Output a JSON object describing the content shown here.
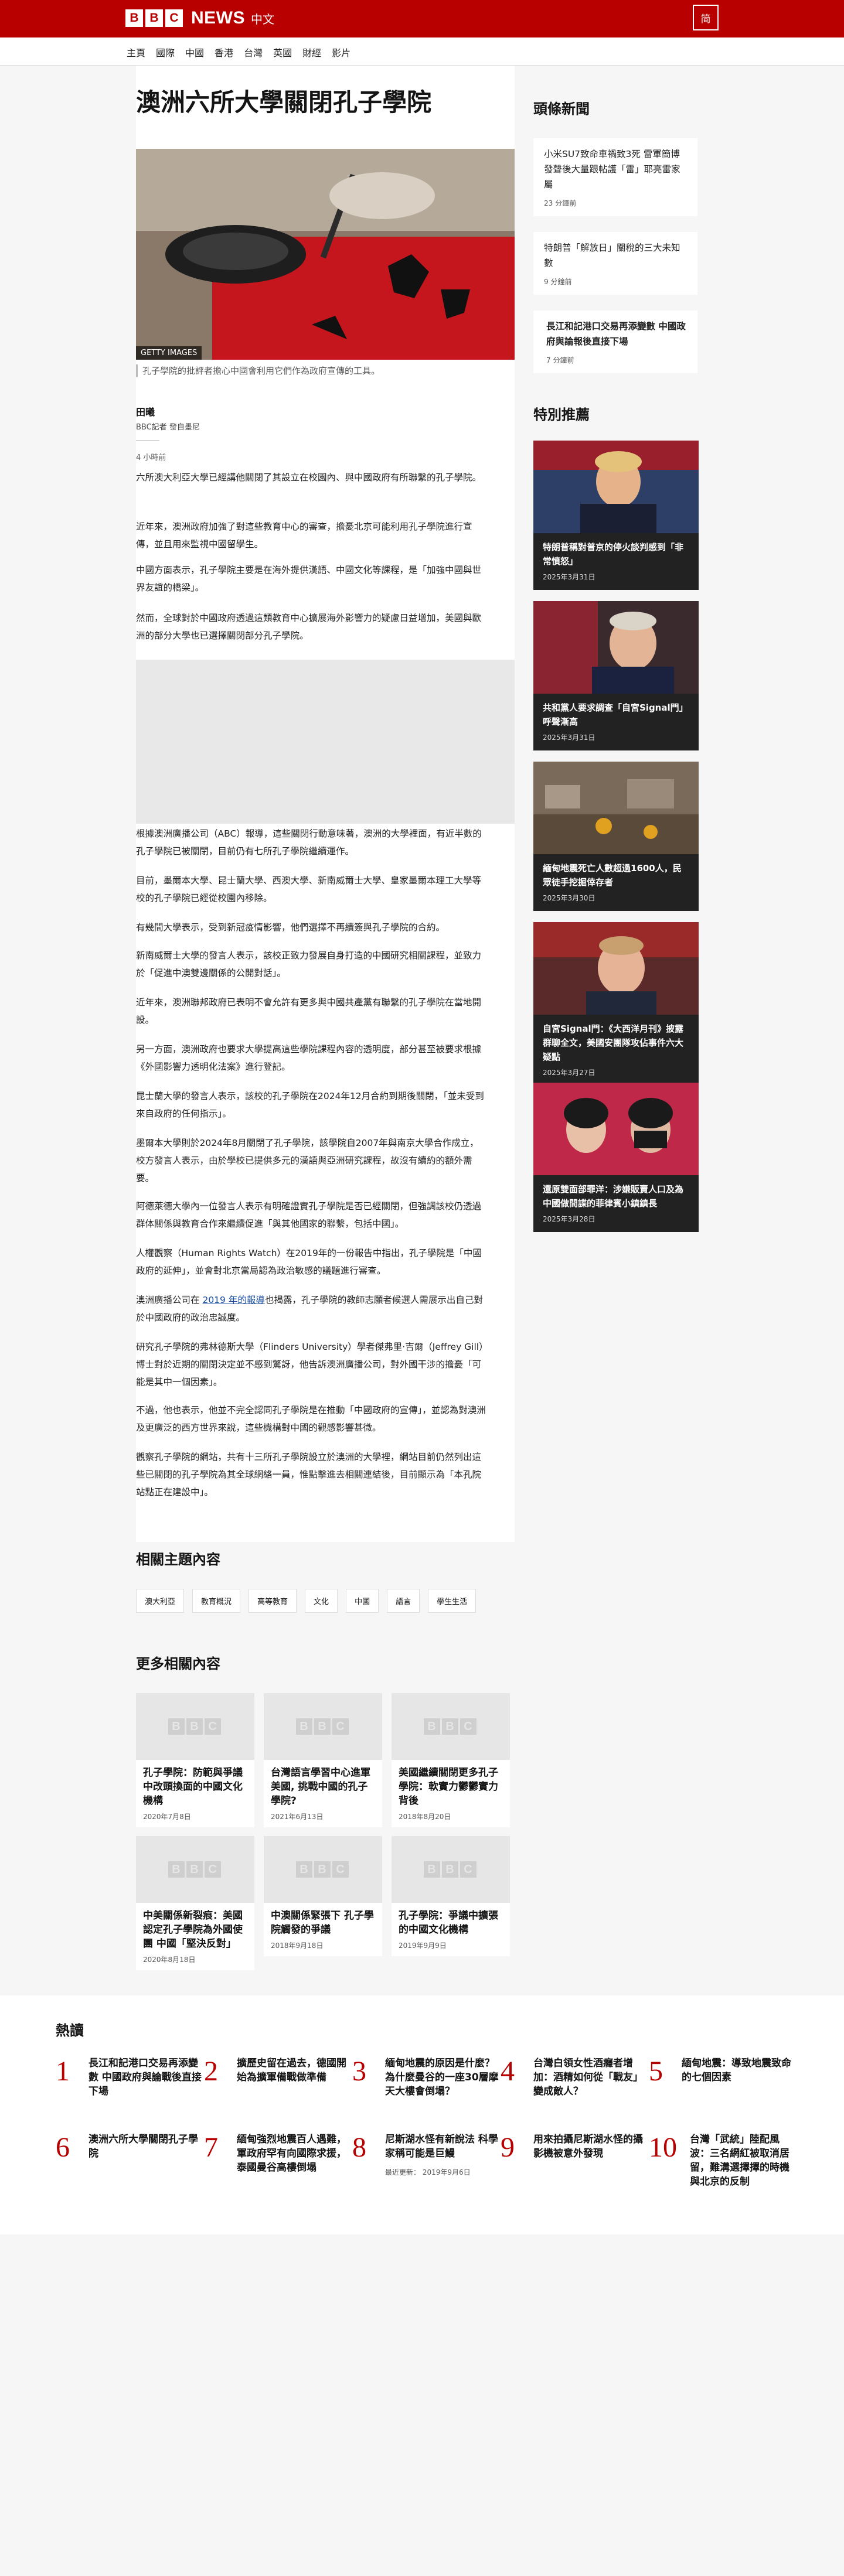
{
  "header": {
    "logo_letters": [
      "B",
      "B",
      "C"
    ],
    "logo_news": "NEWS",
    "edition": "中文",
    "lang_toggle": "简"
  },
  "nav": [
    "主頁",
    "國際",
    "中國",
    "香港",
    "台灣",
    "英國",
    "財經",
    "影片"
  ],
  "article": {
    "headline": "澳洲六所大學關閉孔子學院",
    "image_credit": "GETTY IMAGES",
    "image_caption": "孔子學院的批評者擔心中國會利用它們作為政府宣傳的工具。",
    "author": "田曦",
    "role": "BBC記者 發自墨尼",
    "time": "4 小時前",
    "paragraphs": [
      "六所澳大利亞大學已經講他關閉了其設立在校園內、與中國政府有所聯繫的孔子學院。",
      "近年來，澳洲政府加強了對這些教育中心的審查，擔憂北京可能利用孔子學院進行宣傳，並且用來監視中國留學生。",
      "中國方面表示，孔子學院主要是在海外提供漢語、中國文化等課程，是「加強中國與世界友誼的橋梁」。",
      "然而，全球對於中國政府透過這類教育中心擴展海外影響力的疑慮日益增加，美國與歐洲的部分大學也已選擇關閉部分孔子學院。",
      "根據澳洲廣播公司（ABC）報導，這些關閉行動意味著，澳洲的大學裡面，有近半數的孔子學院已被關閉，目前仍有七所孔子學院繼續運作。",
      "目前，墨爾本大學、昆士蘭大學、西澳大學、新南威爾士大學、皇家墨爾本理工大學等校的孔子學院已經從校園內移除。",
      "有幾間大學表示，受到新冠疫情影響，他們選擇不再續簽與孔子學院的合約。",
      "新南威爾士大學的發言人表示，該校正致力發展自身打造的中國研究相關課程，並致力於「促進中澳雙邊關係的公開對話」。",
      "近年來，澳洲聯邦政府已表明不會允許有更多與中國共產黨有聯繫的孔子學院在當地開設。",
      "另一方面，澳洲政府也要求大學提高這些學院課程內容的透明度，部分甚至被要求根據《外國影響力透明化法案》進行登記。",
      "昆士蘭大學的發言人表示，該校的孔子學院在2024年12月合約到期後關閉，「並未受到來自政府的任何指示」。",
      "墨爾本大學則於2024年8月關閉了孔子學院，該學院自2007年與南京大學合作成立，校方發言人表示，由於學校已提供多元的漢語與亞洲研究課程，故沒有續約的額外需要。",
      "阿德萊德大學內一位發言人表示有明確證實孔子學院是否已經關閉，但強調該校仍透過群体關係與教育合作來繼續促進「與其他國家的聯繫，包括中國」。",
      "人權觀察（Human Rights Watch）在2019年的一份報告中指出，孔子學院是「中國政府的延伸」，並會對北京當局認為政治敏感的議題進行審查。",
      "研究孔子學院的弗林德斯大學（Flinders University）學者傑弗里·吉爾（Jeffrey Gill）博士對於近期的關閉決定並不感到驚訝，他告訴澳洲廣播公司，對外國干涉的擔憂「可能是其中一個因素」。",
      "不過，他也表示，他並不完全認同孔子學院是在推動「中國政府的宣傳」，並認為對澳洲及更廣泛的西方世界來說，這些機構對中國的觀感影響甚微。",
      "觀察孔子學院的網站，共有十三所孔子學院設立於澳洲的大學裡，網站目前仍然列出這些已關閉的孔子學院為其全球網絡一員，惟點擊進去相關連結後，目前顯示為「本孔院站點正在建設中」。"
    ],
    "link_para_before": "澳洲廣播公司在",
    "link_text": "2019 年的報導",
    "link_para_after": "也揭露，孔子學院的教師志願者候選人需展示出自己對於中國政府的政治忠誠度。"
  },
  "topics": {
    "title": "相關主題內容",
    "items": [
      "澳大利亞",
      "教育概況",
      "高等教育",
      "文化",
      "中國",
      "語言",
      "學生生活"
    ]
  },
  "more": {
    "title": "更多相關內容",
    "items": [
      {
        "title": "孔子學院：防範與爭議中改頭換面的中國文化機構",
        "date": "2020年7月8日"
      },
      {
        "title": "台灣語言學習中心進軍美國, 挑戰中國的孔子學院?",
        "date": "2021年6月13日"
      },
      {
        "title": "美國繼續關閉更多孔子學院：軟實力鬱鬱實力背後",
        "date": "2018年8月20日"
      },
      {
        "title": "中美關係新裂痕：美國認定孔子學院為外國使團 中國「堅決反對」",
        "date": "2020年8月18日"
      },
      {
        "title": "中澳關係緊張下 孔子學院觸發的爭議",
        "date": "2018年9月18日"
      },
      {
        "title": "孔子學院：爭議中擴張的中國文化機構",
        "date": "2019年9月9日"
      }
    ]
  },
  "sidebar": {
    "headlines_title": "頭條新聞",
    "headlines": [
      {
        "title": "小米SU7致命車禍致3死 雷軍簡博發聲後大量跟帖護「雷」耶亮雷家屬",
        "time": "23 分鐘前"
      },
      {
        "title": "特朗普「解放日」關稅的三大未知數",
        "time": "9 分鐘前"
      },
      {
        "title": "長江和記港口交易再添變數 中國政府與論報後直接下場",
        "time": "7 分鐘前"
      }
    ],
    "featured_title": "特別推薦",
    "featured": [
      {
        "title": "特朗普稱對普京的停火談判感到「非常憤怒」",
        "date": "2025年3月31日",
        "color": "#3c4a6a"
      },
      {
        "title": "共和黨人要求調查「自宮Signal門」呼聲漸高",
        "date": "2025年3月31日",
        "color": "#4a3a3a"
      },
      {
        "title": "緬甸地震死亡人數超過1600人，民眾徒手挖掘倖存者",
        "date": "2025年3月30日",
        "color": "#6a5a4a"
      },
      {
        "title": "自宮Signal門：《大西洋月刊》披露群聊全文，美國安團隊攻佔事件六大疑點",
        "date": "2025年3月27日",
        "color": "#5a3030"
      },
      {
        "title": "還原雙面部罪洋：涉嫌販賣人口及為中國做間諜的菲律賓小鎮鎮長",
        "date": "2025年3月28日",
        "color": "#c0284a"
      }
    ]
  },
  "popular": {
    "title": "熱讀",
    "items": [
      {
        "n": "1",
        "title": "長江和記港口交易再添變數 中國政府與論戰後直接下場"
      },
      {
        "n": "2",
        "title": "擴歷史留在過去，德國開始為擴軍備戰做準備"
      },
      {
        "n": "3",
        "title": "緬甸地震的原因是什麼？為什麼曼谷的一座30層摩天大樓會倒塌？"
      },
      {
        "n": "4",
        "title": "台灣白領女性酒癮者增加：酒精如何從「戰友」變成敵人？"
      },
      {
        "n": "5",
        "title": "緬甸地震：導致地震致命的七個因素"
      },
      {
        "n": "6",
        "title": "澳洲六所大學關閉孔子學院"
      },
      {
        "n": "7",
        "title": "緬甸強烈地震百人遇難，軍政府罕有向國際求援，泰國曼谷高樓倒塌"
      },
      {
        "n": "8",
        "title": "尼斯湖水怪有新說法 科學家稱可能是巨鰻",
        "date": "最近更新： 2019年9月6日"
      },
      {
        "n": "9",
        "title": "用來拍攝尼斯湖水怪的攝影機被意外發現"
      },
      {
        "n": "10",
        "title": "台灣「武統」陸配風波：三名網紅被取消居留，難溝選擇擇的時機與北京的反制"
      }
    ]
  },
  "colors": {
    "brand": "#b80000",
    "accent_number": "#b80000"
  }
}
